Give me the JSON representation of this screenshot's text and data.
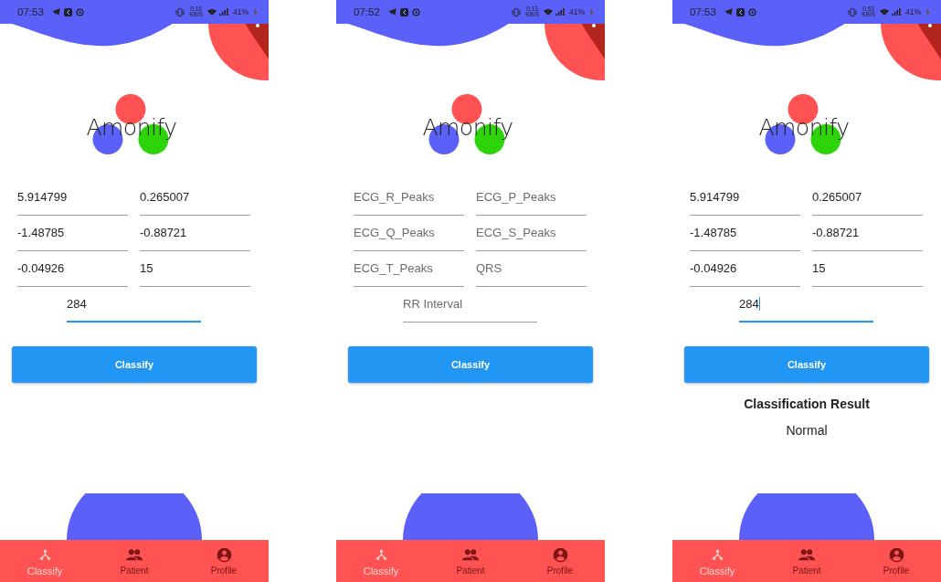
{
  "screens": [
    {
      "status_bar": {
        "time": "07:53",
        "speed": "0.16",
        "speed_unit": "KB/S",
        "battery": "41%"
      },
      "logo": "Amonify",
      "fields": [
        {
          "value": "5.914799",
          "focused": false,
          "caret": false
        },
        {
          "value": "0.265007",
          "focused": false,
          "caret": false
        },
        {
          "value": "-1.48785",
          "focused": false,
          "caret": false
        },
        {
          "value": "-0.88721",
          "focused": false,
          "caret": false
        },
        {
          "value": "-0.04926",
          "focused": false,
          "caret": false
        },
        {
          "value": "15",
          "focused": false,
          "caret": false
        },
        {
          "value": "284",
          "focused": true,
          "caret": false
        }
      ],
      "button": "Classify",
      "nav": [
        {
          "label": "Classify",
          "selected": true
        },
        {
          "label": "Patient",
          "selected": false
        },
        {
          "label": "Profile",
          "selected": false
        }
      ]
    },
    {
      "status_bar": {
        "time": "07:52",
        "speed": "0.13",
        "speed_unit": "KB/S",
        "battery": "41%"
      },
      "logo": "Amonify",
      "fields": [
        {
          "placeholder": "ECG_R_Peaks",
          "focused": false,
          "caret": false
        },
        {
          "placeholder": "ECG_P_Peaks",
          "focused": false,
          "caret": false
        },
        {
          "placeholder": "ECG_Q_Peaks",
          "focused": false,
          "caret": false
        },
        {
          "placeholder": "ECG_S_Peaks",
          "focused": false,
          "caret": false
        },
        {
          "placeholder": "ECG_T_Peaks",
          "focused": false,
          "caret": false
        },
        {
          "placeholder": "QRS",
          "focused": false,
          "caret": false
        },
        {
          "placeholder": "RR Interval",
          "focused": false,
          "caret": false
        }
      ],
      "button": "Classify",
      "nav": [
        {
          "label": "Classify",
          "selected": true
        },
        {
          "label": "Patient",
          "selected": false
        },
        {
          "label": "Profile",
          "selected": false
        }
      ]
    },
    {
      "status_bar": {
        "time": "07:53",
        "speed": "0.53",
        "speed_unit": "KB/S",
        "battery": "41%"
      },
      "logo": "Amonify",
      "fields": [
        {
          "value": "5.914799",
          "focused": false,
          "caret": false
        },
        {
          "value": "0.265007",
          "focused": false,
          "caret": false
        },
        {
          "value": "-1.48785",
          "focused": false,
          "caret": false
        },
        {
          "value": "-0.88721",
          "focused": false,
          "caret": false
        },
        {
          "value": "-0.04926",
          "focused": false,
          "caret": false
        },
        {
          "value": "15",
          "focused": false,
          "caret": false
        },
        {
          "value": "284",
          "focused": true,
          "caret": true
        }
      ],
      "button": "Classify",
      "result": {
        "title": "Classification Result",
        "value": "Normal"
      },
      "nav": [
        {
          "label": "Classify",
          "selected": true
        },
        {
          "label": "Patient",
          "selected": false
        },
        {
          "label": "Profile",
          "selected": false
        }
      ]
    }
  ]
}
